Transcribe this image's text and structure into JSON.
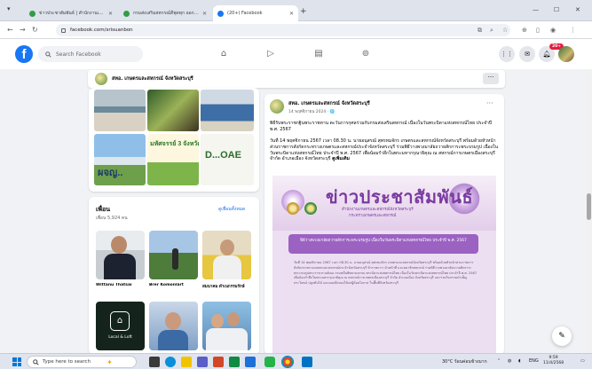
{
  "browser": {
    "tabs": [
      {
        "label": "ข่าวประชาสัมพันธ์ | สำนักงานเกษตร...",
        "fav": "#2f9e44"
      },
      {
        "label": "กรมส่งเสริมสหกรณ์ดีพุดทุก ออกใหม่...",
        "fav": "#2f9e44"
      },
      {
        "label": "(20+) Facebook",
        "fav": "#1877f2"
      }
    ],
    "new_tab": "+",
    "address": "facebook.com/srisuanbon"
  },
  "facebook": {
    "logo": "f",
    "search_placeholder": "Search Facebook",
    "notification_count": "20+"
  },
  "page_header": {
    "name": "สทอ. เกษตรและสหกรณ์ จังหวัดสระบุรี",
    "more": "···"
  },
  "photos": {
    "tile_caption_1": "มหัศจรรย์ 3 จังหวัด",
    "tile_caption_2": "ผจญ..",
    "doae_text": "D...OAE"
  },
  "friends": {
    "title": "เพื่อน",
    "count": "เพื่อน 5,924 คน",
    "see_all": "ดูเพื่อนทั้งหมด",
    "items": [
      {
        "name": "Wittanu Thatsai"
      },
      {
        "name": "Brer Komonlart"
      },
      {
        "name": "สมนาคม ดำเนกรรมรักษ์"
      }
    ],
    "tile_label": "Local & Loft"
  },
  "post": {
    "author": "สทอ. เกษตรและสหกรณ์ จังหวัดสระบุรี",
    "date": "14 พฤศจิกายน 2024 · 🌐",
    "title": "พิธีรับพระราชกฐินพระราชทาน ตะวันการกุศลร่วมกับกรมส่งเสริมสหกรณ์ เนื่องในวันพระบิดาแห่งสหกรณ์ไทย ประจำปี พ.ศ. 2567",
    "body": "วันที่ 14 พฤศจิกายน 2567 เวลา 08.30 น. นายอนุสรณ์ สุพรหมจักร เกษตรและสหกรณ์จังหวัดสระบุรี พร้อมด้วยหัวหน้าส่วนราชการสังกัดกระทรวงเกษตรและสหกรณ์ประจำจังหวัดสระบุรี ร่วมพิธีวางพวงมาลัยถวายสักการะพระบรมรูป เนื่องในวันพระบิดาแห่งสหกรณ์ไทย ประจำปี พ.ศ. 2567 เพื่อน้อมรำลึกในพระมหากรุณาธิคุณ ณ สหกรณ์การเกษตรเมืองสระบุรี จำกัด อำเภอเมือง จังหวัดสระบุรี",
    "see_more": "ดูเพิ่มเติม"
  },
  "promo": {
    "headline": "ข่าวประชาสัมพันธ์",
    "sub1": "สำนักงานเกษตรและสหกรณ์จังหวัดสระบุรี",
    "sub2": "กระทรวงเกษตรและสหกรณ์",
    "bar_text": "พิธีวางพวงมาลัยถวายสักการะพระบรมรูป เนื่องในวันพระบิดาแห่งสหกรณ์ไทย ประจำปี พ.ศ. 2567",
    "doc": "วันที่ 14 พฤศจิกายน 2567 เวลา 08.30 น. นายอนุสรณ์ สุพรหมจักร เกษตรและสหกรณ์จังหวัดสระบุรี พร้อมด้วยหัวหน้าส่วนราชการสังกัดกระทรวงเกษตรและสหกรณ์ประจำจังหวัดสระบุรี ข้าราชการ เจ้าหน้าที่ และสมาชิกสหกรณ์ ร่วมพิธีวางพวงมาลัยถวายสักการะพระบรมรูปพระราชวรวงศ์เธอ กรมหมื่นพิทยาลงกรณ พระบิดาแห่งสหกรณ์ไทย เนื่องในวันพระบิดาแห่งสหกรณ์ไทย ประจำปี พ.ศ. 2567 เพื่อน้อมรำลึกในพระมหากรุณาธิคุณ ณ สหกรณ์การเกษตรเมืองสระบุรี จำกัด อำเภอเมือง จังหวัดสระบุรี และร่วมกิจกรรมบำเพ็ญประโยชน์ ปลูกต้นไม้ และมอบสิ่งของให้แก่ผู้ด้อยโอกาส ในพื้นที่จังหวัดสระบุรี"
  },
  "taskbar": {
    "search_placeholder": "Type here to search",
    "weather": "30°C ร้อนค่อนข้างมาก",
    "lang": "ENG",
    "time": "9:59",
    "date": "11/4/2568"
  }
}
